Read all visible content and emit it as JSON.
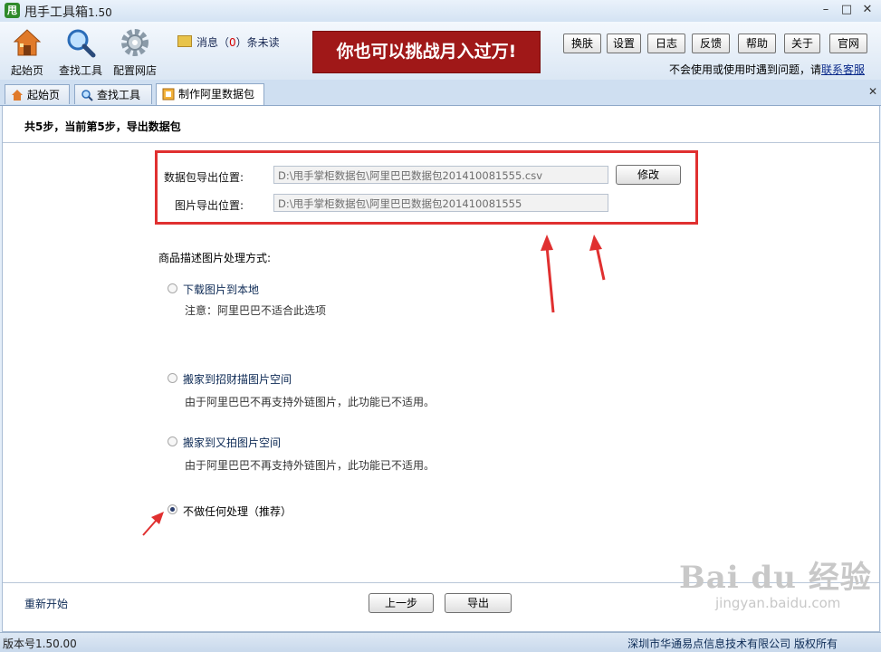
{
  "window": {
    "title": "甩手工具箱",
    "version": "1.50",
    "app_icon_text": "甩"
  },
  "toolbar": {
    "home": "起始页",
    "find_tools": "查找工具",
    "config_shop": "配置网店",
    "message_prefix": "消息（",
    "message_count": "0",
    "message_suffix": "）条未读",
    "banner": "你也可以挑战月入过万!",
    "buttons": [
      "换肤",
      "设置",
      "日志",
      "反馈",
      "帮助",
      "关于",
      "官网"
    ],
    "help_text": "不会使用或使用时遇到问题，请",
    "help_link": "联系客服"
  },
  "tabs": [
    "起始页",
    "查找工具",
    "制作阿里数据包"
  ],
  "content": {
    "steps": "共5步，当前第5步，导出数据包",
    "export_location_label": "数据包导出位置:",
    "export_location_value": "D:\\甩手掌柜数据包\\阿里巴巴数据包201410081555.csv",
    "modify_button": "修改",
    "image_location_label": "图片导出位置:",
    "image_location_value": "D:\\甩手掌柜数据包\\阿里巴巴数据包201410081555",
    "section_title": "商品描述图片处理方式:",
    "options": [
      {
        "label": "下载图片到本地",
        "note": "注意：阿里巴巴不适合此选项",
        "selected": false
      },
      {
        "label": "搬家到招财描图片空间",
        "note": "由于阿里巴巴不再支持外链图片，此功能已不适用。",
        "selected": false
      },
      {
        "label": "搬家到又拍图片空间",
        "note": "由于阿里巴巴不再支持外链图片，此功能已不适用。",
        "selected": false
      },
      {
        "label": "不做任何处理（推荐）",
        "note": "",
        "selected": true
      }
    ],
    "restart": "重新开始",
    "prev_button": "上一步",
    "export_button": "导出"
  },
  "status": {
    "version": "版本号1.50.00",
    "copyright": "深圳市华通易点信息技术有限公司 版权所有"
  },
  "watermark": {
    "big": "Bai du 经验",
    "small": "jingyan.baidu.com"
  },
  "colors": {
    "banner": "#a01818",
    "annotation_red": "#e03030"
  }
}
